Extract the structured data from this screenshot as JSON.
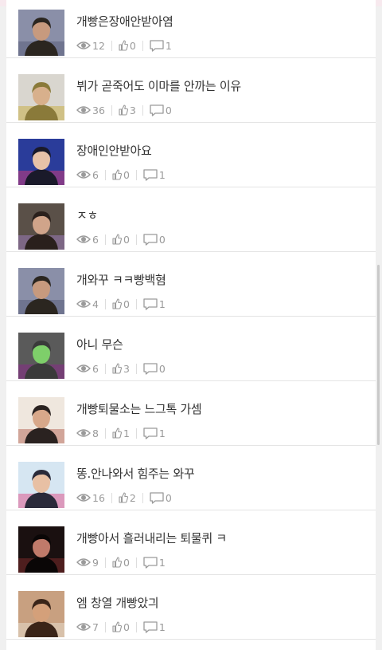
{
  "posts": [
    {
      "title": "개빵은장애안받아염",
      "views": "12",
      "likes": "0",
      "comments": "1",
      "thumb": {
        "bg": "#8a8fa8",
        "fg": "#2b2620",
        "skin": "#c79a7e",
        "accent": "#5a5f7a"
      }
    },
    {
      "title": "뷔가 곧죽어도 이마를 안까는 이유",
      "views": "36",
      "likes": "3",
      "comments": "0",
      "thumb": {
        "bg": "#d9d6cf",
        "fg": "#8a7a3a",
        "skin": "#d8b08c",
        "accent": "#c9b04a"
      }
    },
    {
      "title": "장애인안받아요",
      "views": "6",
      "likes": "0",
      "comments": "1",
      "thumb": {
        "bg": "#2a3c9a",
        "fg": "#1a1a2a",
        "skin": "#e7c2a8",
        "accent": "#c93a7a"
      }
    },
    {
      "title": "ㅈㅎ",
      "views": "6",
      "likes": "0",
      "comments": "0",
      "thumb": {
        "bg": "#5a5048",
        "fg": "#2a201c",
        "skin": "#d0a48a",
        "accent": "#9a7ab8"
      }
    },
    {
      "title": "개와꾸 ㅋㅋ빵백혐",
      "views": "4",
      "likes": "0",
      "comments": "1",
      "thumb": {
        "bg": "#8a8fa8",
        "fg": "#2b2620",
        "skin": "#c79a7e",
        "accent": "#5a5f7a"
      }
    },
    {
      "title": "아니 무슨",
      "views": "6",
      "likes": "3",
      "comments": "0",
      "thumb": {
        "bg": "#5a5a5a",
        "fg": "#3a3a3a",
        "skin": "#7ecf6a",
        "accent": "#8a2a8a"
      }
    },
    {
      "title": "개빵퇴물소는 느그톡 가셈",
      "views": "8",
      "likes": "1",
      "comments": "1",
      "thumb": {
        "bg": "#efe7de",
        "fg": "#2a2220",
        "skin": "#d8a88a",
        "accent": "#b87060"
      }
    },
    {
      "title": "똥.안나와서 힘주는 와꾸",
      "views": "16",
      "likes": "2",
      "comments": "0",
      "thumb": {
        "bg": "#d6e6f2",
        "fg": "#2a2a3a",
        "skin": "#e8c0a4",
        "accent": "#e05a90"
      }
    },
    {
      "title": "개빵아서 흘러내리는 퇴물퀴 ㅋ",
      "views": "9",
      "likes": "0",
      "comments": "1",
      "thumb": {
        "bg": "#1a1010",
        "fg": "#0a0606",
        "skin": "#c07a6a",
        "accent": "#7a2a2a"
      }
    },
    {
      "title": "엠 창열 개빵았긔",
      "views": "7",
      "likes": "0",
      "comments": "1",
      "thumb": {
        "bg": "#c8a080",
        "fg": "#3a2418",
        "skin": "#d4a07a",
        "accent": "#e6dccc"
      }
    }
  ],
  "icons": {
    "views": "eye-icon",
    "likes": "thumbs-up-icon",
    "comments": "comment-icon"
  },
  "colors": {
    "stat_text": "#9a9a9a",
    "title_text": "#333333",
    "divider": "#e4e4e4"
  }
}
